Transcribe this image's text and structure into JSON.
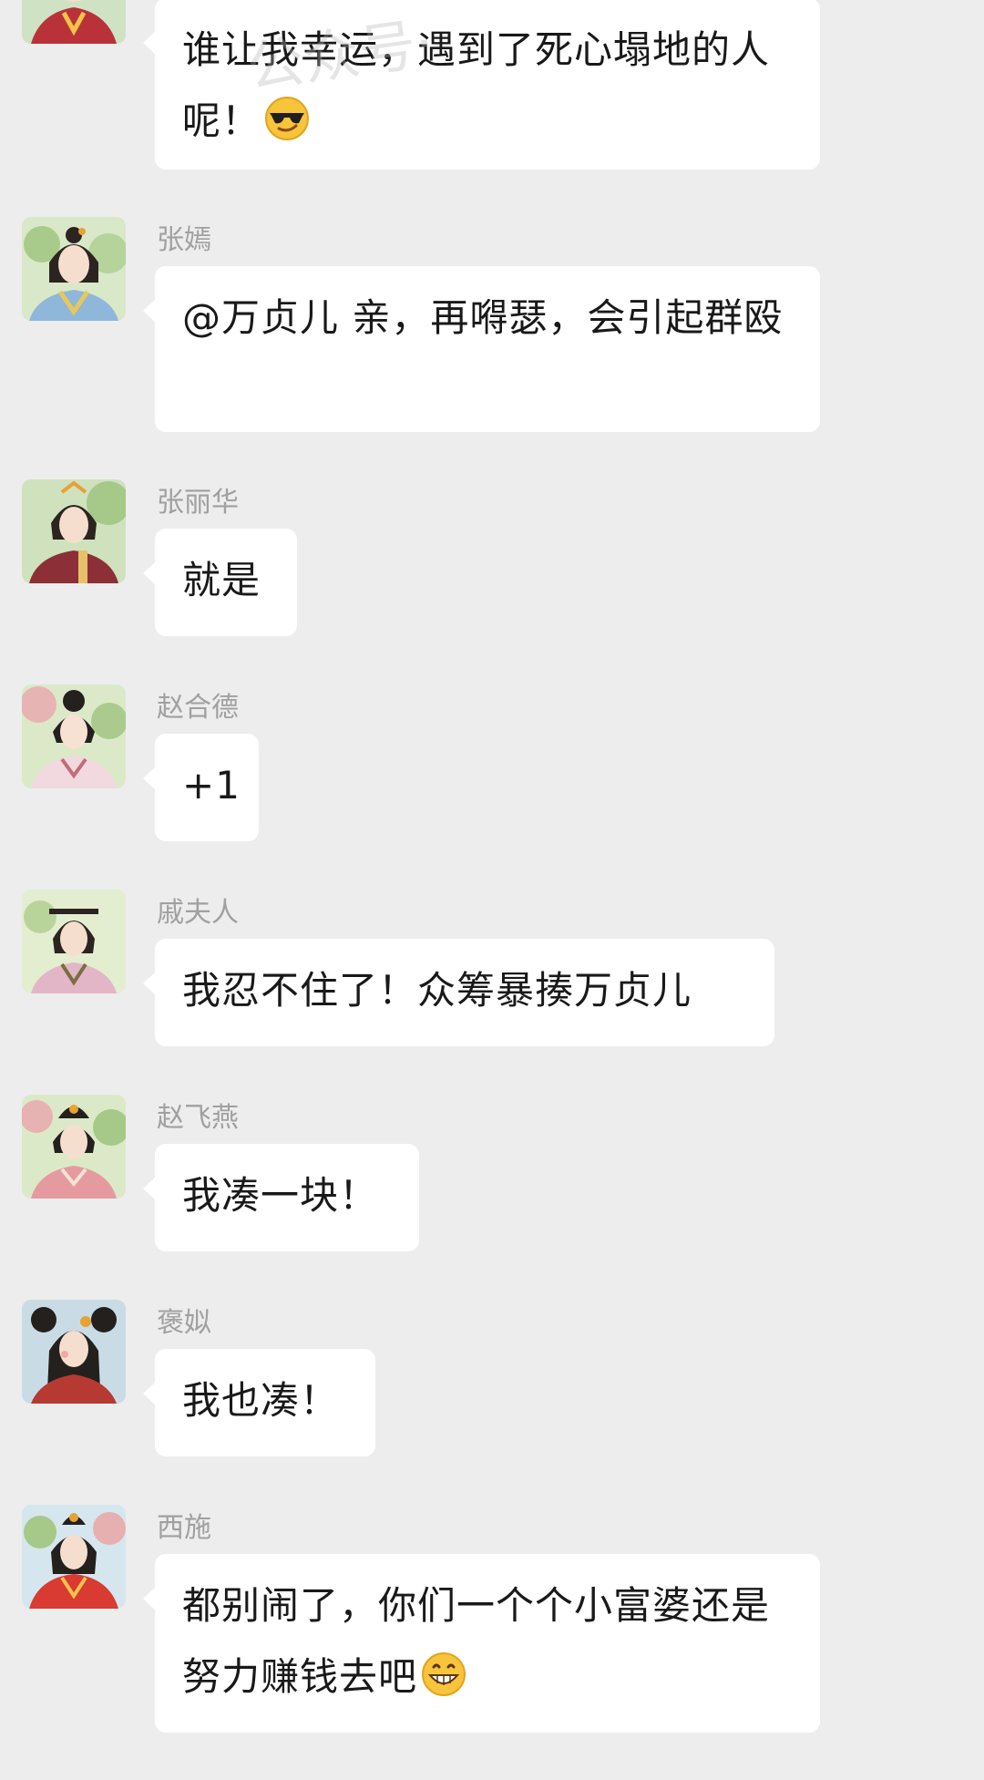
{
  "watermark": "公众号·",
  "messages": [
    {
      "sender": "",
      "text": "谁让我幸运，遇到了死心塌地的人呢！",
      "emoji": "sunglasses-emoji"
    },
    {
      "sender": "张嫣",
      "text": "@万贞儿 亲，再嘚瑟，会引起群殴"
    },
    {
      "sender": "张丽华",
      "text": "就是"
    },
    {
      "sender": "赵合德",
      "text": "+1"
    },
    {
      "sender": "戚夫人",
      "text": "我忍不住了！众筹暴揍万贞儿"
    },
    {
      "sender": "赵飞燕",
      "text": "我凑一块！"
    },
    {
      "sender": "褒姒",
      "text": "我也凑！"
    },
    {
      "sender": "西施",
      "text": "都别闹了，你们一个个小富婆还是努力赚钱去吧",
      "emoji": "grin-emoji"
    }
  ]
}
